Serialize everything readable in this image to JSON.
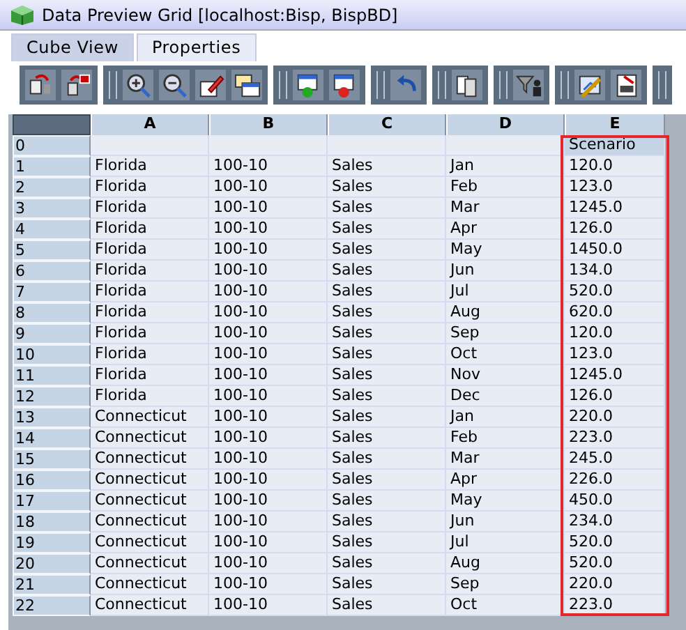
{
  "window": {
    "title": "Data Preview Grid [localhost:Bisp, BispBD]"
  },
  "tabs": [
    {
      "label": "Cube View",
      "selected": true
    },
    {
      "label": "Properties",
      "selected": false
    }
  ],
  "grid": {
    "columns": [
      {
        "label": "A",
        "highlighted": false
      },
      {
        "label": "B",
        "highlighted": false
      },
      {
        "label": "C",
        "highlighted": false
      },
      {
        "label": "D",
        "highlighted": false
      },
      {
        "label": "E",
        "highlighted": true
      }
    ],
    "rows": [
      {
        "header": "0",
        "cells": [
          "",
          "",
          "",
          "",
          "Scenario"
        ]
      },
      {
        "header": "1",
        "cells": [
          "Florida",
          "100-10",
          "Sales",
          "Jan",
          "120.0"
        ]
      },
      {
        "header": "2",
        "cells": [
          "Florida",
          "100-10",
          "Sales",
          "Feb",
          "123.0"
        ]
      },
      {
        "header": "3",
        "cells": [
          "Florida",
          "100-10",
          "Sales",
          "Mar",
          "1245.0"
        ]
      },
      {
        "header": "4",
        "cells": [
          "Florida",
          "100-10",
          "Sales",
          "Apr",
          "126.0"
        ]
      },
      {
        "header": "5",
        "cells": [
          "Florida",
          "100-10",
          "Sales",
          "May",
          "1450.0"
        ]
      },
      {
        "header": "6",
        "cells": [
          "Florida",
          "100-10",
          "Sales",
          "Jun",
          "134.0"
        ]
      },
      {
        "header": "7",
        "cells": [
          "Florida",
          "100-10",
          "Sales",
          "Jul",
          "520.0"
        ]
      },
      {
        "header": "8",
        "cells": [
          "Florida",
          "100-10",
          "Sales",
          "Aug",
          "620.0"
        ]
      },
      {
        "header": "9",
        "cells": [
          "Florida",
          "100-10",
          "Sales",
          "Sep",
          "120.0"
        ]
      },
      {
        "header": "10",
        "cells": [
          "Florida",
          "100-10",
          "Sales",
          "Oct",
          "123.0"
        ]
      },
      {
        "header": "11",
        "cells": [
          "Florida",
          "100-10",
          "Sales",
          "Nov",
          "1245.0"
        ]
      },
      {
        "header": "12",
        "cells": [
          "Florida",
          "100-10",
          "Sales",
          "Dec",
          "126.0"
        ]
      },
      {
        "header": "13",
        "cells": [
          "Connecticut",
          "100-10",
          "Sales",
          "Jan",
          "220.0"
        ]
      },
      {
        "header": "14",
        "cells": [
          "Connecticut",
          "100-10",
          "Sales",
          "Feb",
          "223.0"
        ]
      },
      {
        "header": "15",
        "cells": [
          "Connecticut",
          "100-10",
          "Sales",
          "Mar",
          "245.0"
        ]
      },
      {
        "header": "16",
        "cells": [
          "Connecticut",
          "100-10",
          "Sales",
          "Apr",
          "226.0"
        ]
      },
      {
        "header": "17",
        "cells": [
          "Connecticut",
          "100-10",
          "Sales",
          "May",
          "450.0"
        ]
      },
      {
        "header": "18",
        "cells": [
          "Connecticut",
          "100-10",
          "Sales",
          "Jun",
          "234.0"
        ]
      },
      {
        "header": "19",
        "cells": [
          "Connecticut",
          "100-10",
          "Sales",
          "Jul",
          "520.0"
        ]
      },
      {
        "header": "20",
        "cells": [
          "Connecticut",
          "100-10",
          "Sales",
          "Aug",
          "520.0"
        ]
      },
      {
        "header": "21",
        "cells": [
          "Connecticut",
          "100-10",
          "Sales",
          "Sep",
          "220.0"
        ]
      },
      {
        "header": "22",
        "cells": [
          "Connecticut",
          "100-10",
          "Sales",
          "Oct",
          "223.0"
        ]
      }
    ]
  }
}
